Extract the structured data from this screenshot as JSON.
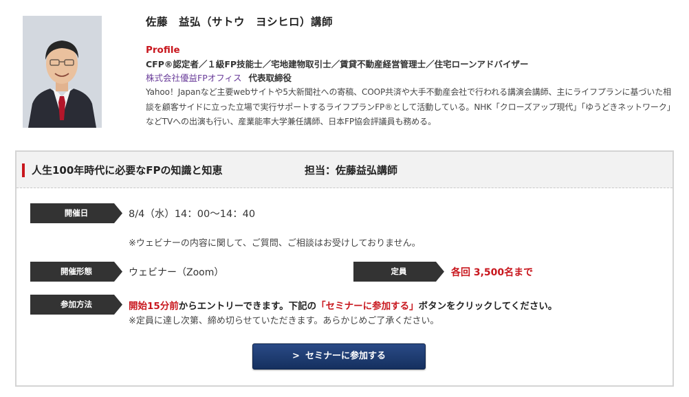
{
  "profile": {
    "name": "佐藤　益弘（サトウ　ヨシヒロ）講師",
    "label": "Profile",
    "qualifications": "CFP®認定者／１級FP技能士／宅地建物取引士／賃貸不動産経営管理士／住宅ローンアドバイザー",
    "company": "株式会社優益FPオフィス",
    "role": "代表取締役",
    "description": "Yahoo！Japanなど主要webサイトや5大新聞社への寄稿、COOP共済や大手不動産会社で行われる講演会講師、主にライフプランに基づいた相談を顧客サイドに立った立場で実行サポートするライフプランFP®として活動している。NHK「クローズアップ現代」「ゆうどきネットワーク」などTVへの出演も行い、産業能率大学兼任講師、日本FP協会評議員も務める。"
  },
  "seminar": {
    "title": "人生100年時代に必要なFPの知識と知恵",
    "teacher": "担当：佐藤益弘講師",
    "date_label": "開催日",
    "date_value": "8/4（水）14：00〜14：40",
    "note": "※ウェビナーの内容に関して、ご質問、ご相談はお受けしておりません。",
    "format_label": "開催形態",
    "format_value": "ウェビナー（Zoom）",
    "capacity_label": "定員",
    "capacity_value": "各回 3,500名まで",
    "method_label": "参加方法",
    "method_part1": "開始15分前",
    "method_part2": "からエントリーできます。下記の",
    "method_part3": "「セミナーに参加する」",
    "method_part4": "ボタンをクリックしてください。",
    "method_note": "※定員に達し次第、締め切らせていただきます。あらかじめご了承ください。",
    "button_label": "セミナーに参加する",
    "button_icon": "chevron-right-icon"
  },
  "colors": {
    "accent_red": "#c8161d",
    "label_dark": "#333333",
    "button_navy": "#1d3a70",
    "link_purple": "#6a3d9a"
  }
}
